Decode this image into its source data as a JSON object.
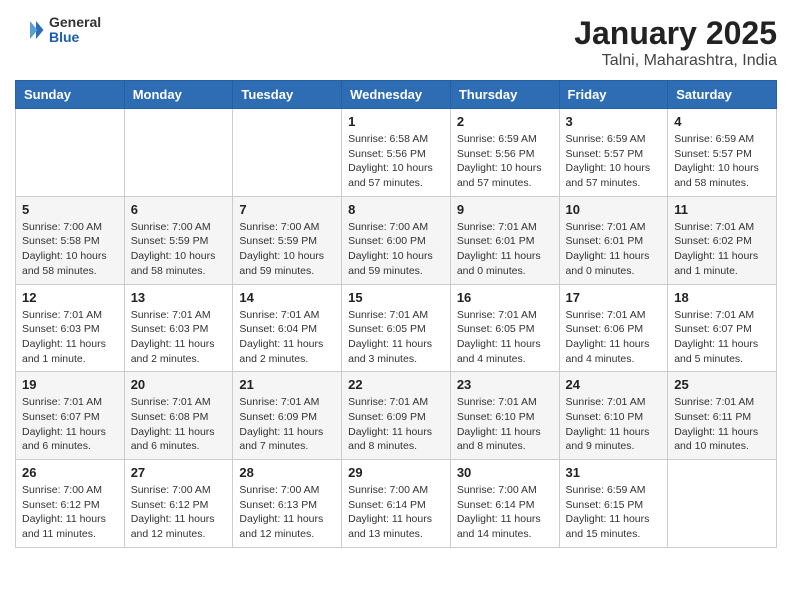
{
  "logo": {
    "general": "General",
    "blue": "Blue"
  },
  "title": "January 2025",
  "subtitle": "Talni, Maharashtra, India",
  "days_of_week": [
    "Sunday",
    "Monday",
    "Tuesday",
    "Wednesday",
    "Thursday",
    "Friday",
    "Saturday"
  ],
  "weeks": [
    [
      {
        "day": "",
        "info": ""
      },
      {
        "day": "",
        "info": ""
      },
      {
        "day": "",
        "info": ""
      },
      {
        "day": "1",
        "info": "Sunrise: 6:58 AM\nSunset: 5:56 PM\nDaylight: 10 hours\nand 57 minutes."
      },
      {
        "day": "2",
        "info": "Sunrise: 6:59 AM\nSunset: 5:56 PM\nDaylight: 10 hours\nand 57 minutes."
      },
      {
        "day": "3",
        "info": "Sunrise: 6:59 AM\nSunset: 5:57 PM\nDaylight: 10 hours\nand 57 minutes."
      },
      {
        "day": "4",
        "info": "Sunrise: 6:59 AM\nSunset: 5:57 PM\nDaylight: 10 hours\nand 58 minutes."
      }
    ],
    [
      {
        "day": "5",
        "info": "Sunrise: 7:00 AM\nSunset: 5:58 PM\nDaylight: 10 hours\nand 58 minutes."
      },
      {
        "day": "6",
        "info": "Sunrise: 7:00 AM\nSunset: 5:59 PM\nDaylight: 10 hours\nand 58 minutes."
      },
      {
        "day": "7",
        "info": "Sunrise: 7:00 AM\nSunset: 5:59 PM\nDaylight: 10 hours\nand 59 minutes."
      },
      {
        "day": "8",
        "info": "Sunrise: 7:00 AM\nSunset: 6:00 PM\nDaylight: 10 hours\nand 59 minutes."
      },
      {
        "day": "9",
        "info": "Sunrise: 7:01 AM\nSunset: 6:01 PM\nDaylight: 11 hours\nand 0 minutes."
      },
      {
        "day": "10",
        "info": "Sunrise: 7:01 AM\nSunset: 6:01 PM\nDaylight: 11 hours\nand 0 minutes."
      },
      {
        "day": "11",
        "info": "Sunrise: 7:01 AM\nSunset: 6:02 PM\nDaylight: 11 hours\nand 1 minute."
      }
    ],
    [
      {
        "day": "12",
        "info": "Sunrise: 7:01 AM\nSunset: 6:03 PM\nDaylight: 11 hours\nand 1 minute."
      },
      {
        "day": "13",
        "info": "Sunrise: 7:01 AM\nSunset: 6:03 PM\nDaylight: 11 hours\nand 2 minutes."
      },
      {
        "day": "14",
        "info": "Sunrise: 7:01 AM\nSunset: 6:04 PM\nDaylight: 11 hours\nand 2 minutes."
      },
      {
        "day": "15",
        "info": "Sunrise: 7:01 AM\nSunset: 6:05 PM\nDaylight: 11 hours\nand 3 minutes."
      },
      {
        "day": "16",
        "info": "Sunrise: 7:01 AM\nSunset: 6:05 PM\nDaylight: 11 hours\nand 4 minutes."
      },
      {
        "day": "17",
        "info": "Sunrise: 7:01 AM\nSunset: 6:06 PM\nDaylight: 11 hours\nand 4 minutes."
      },
      {
        "day": "18",
        "info": "Sunrise: 7:01 AM\nSunset: 6:07 PM\nDaylight: 11 hours\nand 5 minutes."
      }
    ],
    [
      {
        "day": "19",
        "info": "Sunrise: 7:01 AM\nSunset: 6:07 PM\nDaylight: 11 hours\nand 6 minutes."
      },
      {
        "day": "20",
        "info": "Sunrise: 7:01 AM\nSunset: 6:08 PM\nDaylight: 11 hours\nand 6 minutes."
      },
      {
        "day": "21",
        "info": "Sunrise: 7:01 AM\nSunset: 6:09 PM\nDaylight: 11 hours\nand 7 minutes."
      },
      {
        "day": "22",
        "info": "Sunrise: 7:01 AM\nSunset: 6:09 PM\nDaylight: 11 hours\nand 8 minutes."
      },
      {
        "day": "23",
        "info": "Sunrise: 7:01 AM\nSunset: 6:10 PM\nDaylight: 11 hours\nand 8 minutes."
      },
      {
        "day": "24",
        "info": "Sunrise: 7:01 AM\nSunset: 6:10 PM\nDaylight: 11 hours\nand 9 minutes."
      },
      {
        "day": "25",
        "info": "Sunrise: 7:01 AM\nSunset: 6:11 PM\nDaylight: 11 hours\nand 10 minutes."
      }
    ],
    [
      {
        "day": "26",
        "info": "Sunrise: 7:00 AM\nSunset: 6:12 PM\nDaylight: 11 hours\nand 11 minutes."
      },
      {
        "day": "27",
        "info": "Sunrise: 7:00 AM\nSunset: 6:12 PM\nDaylight: 11 hours\nand 12 minutes."
      },
      {
        "day": "28",
        "info": "Sunrise: 7:00 AM\nSunset: 6:13 PM\nDaylight: 11 hours\nand 12 minutes."
      },
      {
        "day": "29",
        "info": "Sunrise: 7:00 AM\nSunset: 6:14 PM\nDaylight: 11 hours\nand 13 minutes."
      },
      {
        "day": "30",
        "info": "Sunrise: 7:00 AM\nSunset: 6:14 PM\nDaylight: 11 hours\nand 14 minutes."
      },
      {
        "day": "31",
        "info": "Sunrise: 6:59 AM\nSunset: 6:15 PM\nDaylight: 11 hours\nand 15 minutes."
      },
      {
        "day": "",
        "info": ""
      }
    ]
  ]
}
